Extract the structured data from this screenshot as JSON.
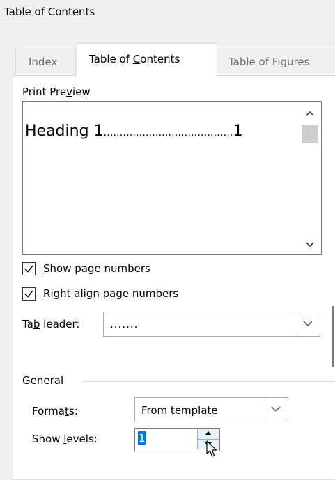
{
  "dialog": {
    "title": "Table of Contents"
  },
  "tabs": {
    "index": "Index",
    "toc_before": "Table of ",
    "toc_underline": "C",
    "toc_after": "ontents",
    "tof": "Table of Figures"
  },
  "preview": {
    "label_before": "Print Pre",
    "label_underline": "v",
    "label_after": "iew",
    "heading_text": "Heading 1",
    "dots": "........................................",
    "page_number": "1"
  },
  "options": {
    "show_page_numbers": {
      "underline": "S",
      "rest": "how page numbers",
      "checked": true
    },
    "right_align": {
      "underline": "R",
      "rest": "ight align page numbers",
      "checked": true
    },
    "tab_leader": {
      "before": "Ta",
      "underline": "b",
      "after": " leader:",
      "value": "......."
    }
  },
  "general": {
    "label": "General",
    "formats": {
      "before": "Forma",
      "underline": "t",
      "after": "s:",
      "value": "From template"
    },
    "show_levels": {
      "before": "Show ",
      "underline": "l",
      "after": "evels:",
      "value": "1"
    }
  },
  "icons": {
    "scroll_up": "chevron-up-icon",
    "scroll_down": "chevron-down-icon",
    "dropdown": "chevron-down-icon",
    "checkmark": "checkmark-icon",
    "cursor": "arrow-cursor-icon"
  }
}
